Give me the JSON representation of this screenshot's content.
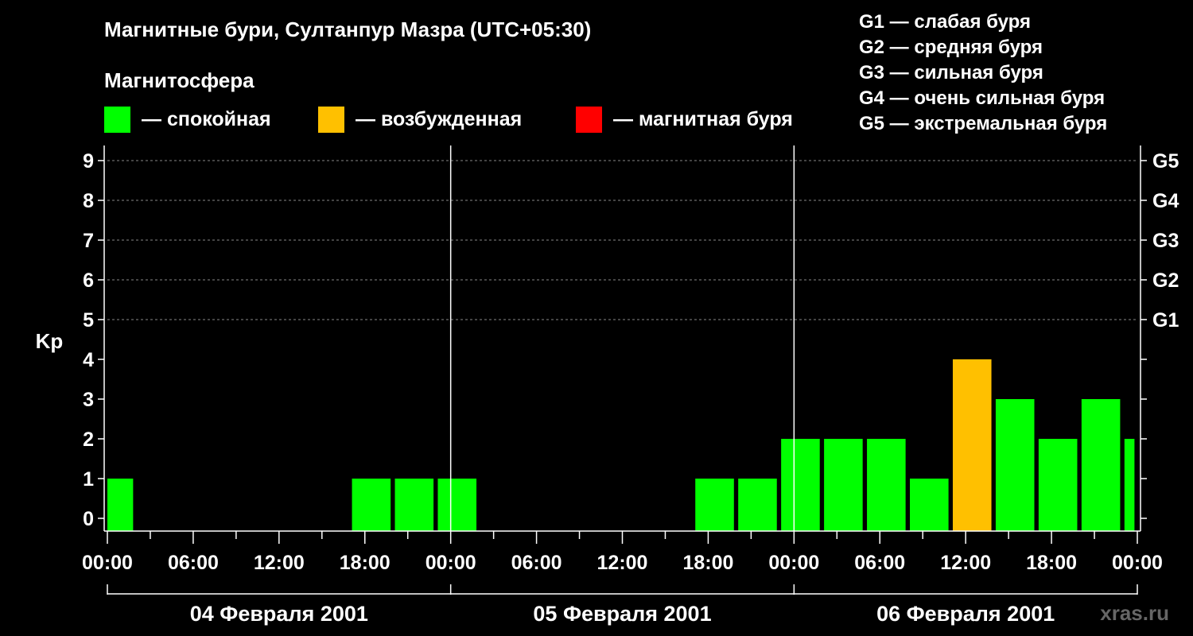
{
  "title": "Магнитные бури, Султанпур Мазра (UTC+05:30)",
  "legend": {
    "title": "Магнитосфера",
    "items": [
      {
        "label": "— спокойная",
        "color": "#00ff00"
      },
      {
        "label": "— возбужденная",
        "color": "#ffc000"
      },
      {
        "label": "— магнитная буря",
        "color": "#ff0000"
      }
    ]
  },
  "g_scale": [
    "G1 — слабая буря",
    "G2 — средняя буря",
    "G3 — сильная буря",
    "G4 — очень сильная буря",
    "G5 — экстремальная буря"
  ],
  "watermark": "xras.ru",
  "chart_data": {
    "type": "bar",
    "ylabel": "Kp",
    "ylim": [
      0,
      9
    ],
    "yticks": [
      0,
      1,
      2,
      3,
      4,
      5,
      6,
      7,
      8,
      9
    ],
    "right_ticks": [
      {
        "value": 5,
        "label": "G1"
      },
      {
        "value": 6,
        "label": "G2"
      },
      {
        "value": 7,
        "label": "G3"
      },
      {
        "value": 8,
        "label": "G4"
      },
      {
        "value": 9,
        "label": "G5"
      }
    ],
    "x_range_hours": [
      0,
      72
    ],
    "xtick_labels": [
      "00:00",
      "06:00",
      "12:00",
      "18:00",
      "00:00",
      "06:00",
      "12:00",
      "18:00",
      "00:00",
      "06:00",
      "12:00",
      "18:00",
      "00:00"
    ],
    "days": [
      "04 Февраля 2001",
      "05 Февраля 2001",
      "06 Февраля 2001"
    ],
    "grid": true,
    "colors": {
      "quiet": "#00ff00",
      "active": "#ffc000",
      "storm": "#ff0000"
    },
    "bars": [
      {
        "start": 0,
        "end": 1.8,
        "kp": 1,
        "level": "quiet"
      },
      {
        "start": 17.1,
        "end": 19.8,
        "kp": 1,
        "level": "quiet"
      },
      {
        "start": 20.1,
        "end": 22.8,
        "kp": 1,
        "level": "quiet"
      },
      {
        "start": 23.1,
        "end": 25.8,
        "kp": 1,
        "level": "quiet"
      },
      {
        "start": 41.1,
        "end": 43.8,
        "kp": 1,
        "level": "quiet"
      },
      {
        "start": 44.1,
        "end": 46.8,
        "kp": 1,
        "level": "quiet"
      },
      {
        "start": 47.1,
        "end": 49.8,
        "kp": 2,
        "level": "quiet"
      },
      {
        "start": 50.1,
        "end": 52.8,
        "kp": 2,
        "level": "quiet"
      },
      {
        "start": 53.1,
        "end": 55.8,
        "kp": 2,
        "level": "quiet"
      },
      {
        "start": 56.1,
        "end": 58.8,
        "kp": 1,
        "level": "quiet"
      },
      {
        "start": 59.1,
        "end": 61.8,
        "kp": 4,
        "level": "active"
      },
      {
        "start": 62.1,
        "end": 64.8,
        "kp": 3,
        "level": "quiet"
      },
      {
        "start": 65.1,
        "end": 67.8,
        "kp": 2,
        "level": "quiet"
      },
      {
        "start": 68.1,
        "end": 70.8,
        "kp": 3,
        "level": "quiet"
      },
      {
        "start": 71.1,
        "end": 71.8,
        "kp": 2,
        "level": "quiet"
      }
    ]
  }
}
